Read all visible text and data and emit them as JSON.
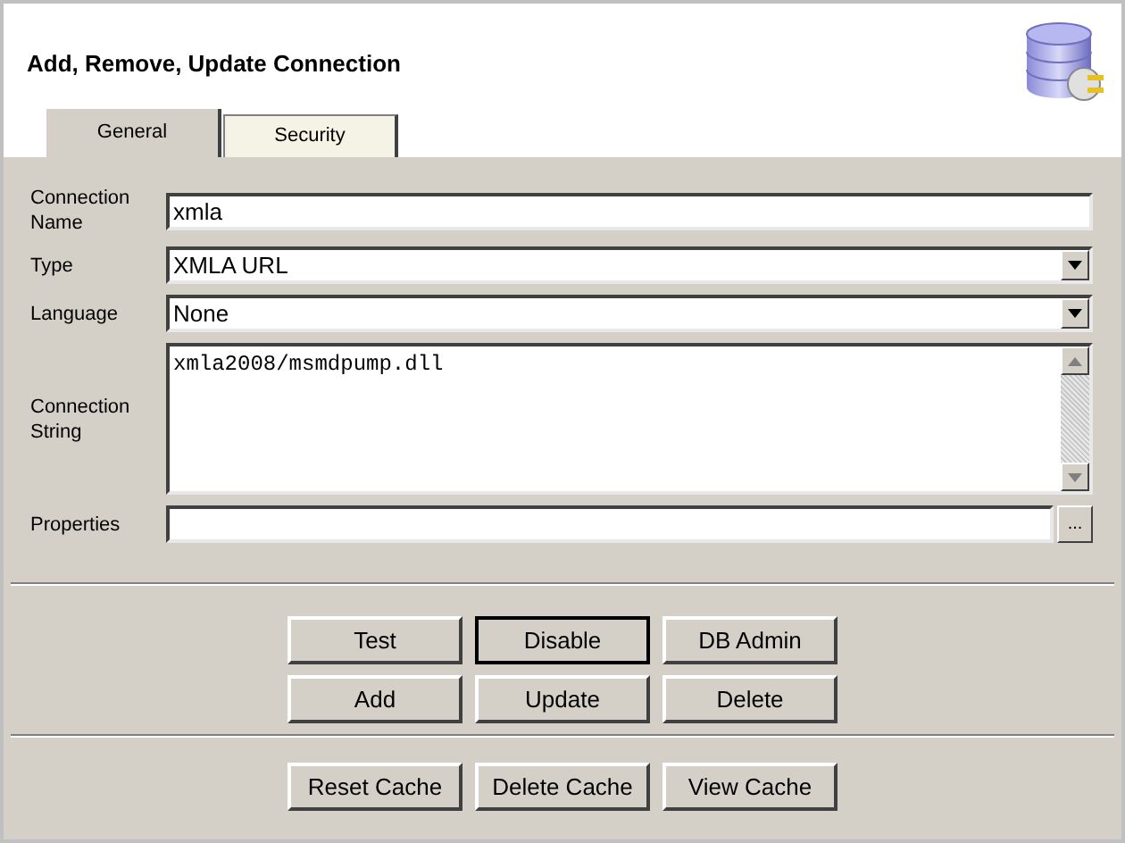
{
  "header": {
    "title": "Add, Remove, Update Connection"
  },
  "tabs": [
    {
      "label": "General",
      "selected": true
    },
    {
      "label": "Security",
      "selected": false
    }
  ],
  "form": [
    {
      "kind": "text",
      "label": "Connection Name",
      "value": "xmla"
    },
    {
      "kind": "select",
      "label": "Type",
      "value": "XMLA URL"
    },
    {
      "kind": "select",
      "label": "Language",
      "value": "None"
    },
    {
      "kind": "textarea",
      "label": "Connection String",
      "value": "xmla2008/msmdpump.dll"
    },
    {
      "kind": "browse",
      "label": "Properties",
      "button": "..."
    }
  ],
  "button_groups": [
    [
      {
        "label": "Test",
        "focused": false
      },
      {
        "label": "Disable",
        "focused": true
      },
      {
        "label": "DB Admin",
        "focused": false
      },
      {
        "label": "Add",
        "focused": false
      },
      {
        "label": "Update",
        "focused": false
      },
      {
        "label": "Delete",
        "focused": false
      }
    ],
    [
      {
        "label": "Reset Cache",
        "focused": false
      },
      {
        "label": "Delete Cache",
        "focused": false
      },
      {
        "label": "View Cache",
        "focused": false
      }
    ]
  ]
}
